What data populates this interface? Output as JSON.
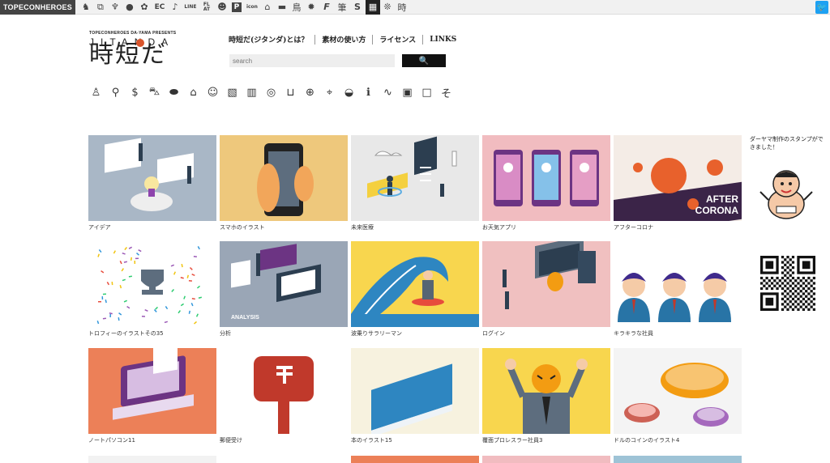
{
  "brand": "TOPECONHEROES",
  "top_icons": [
    "horse-icon",
    "copy-icon",
    "figure-icon",
    "chat-icon",
    "flower-icon",
    "EC",
    "music-icon",
    "LINE",
    "smile-icon",
    "P",
    "icon",
    "house-icon",
    "sofa-icon",
    "鳥",
    "blob-icon",
    "F",
    "筆",
    "S",
    "grid-icon",
    "時"
  ],
  "top_icon_labels": {
    "ec": "EC",
    "line": "LINE",
    "flat": "FL\nAT",
    "p": "P",
    "icon": "icon",
    "bird": "鳥",
    "f": "F",
    "fude": "筆",
    "s": "S",
    "ji": "時"
  },
  "logo": {
    "presents": "TOPECONHEROES DA-YAMA PRESENTS",
    "sub": "JITANDA",
    "title": "時短だ"
  },
  "nav": {
    "about": "時短だ(ジタンダ)とは？",
    "usage": "素材の使い方",
    "license": "ライセンス",
    "links": "LINKS"
  },
  "search": {
    "placeholder": "search"
  },
  "categories": [
    "person-icon",
    "tie-icon",
    "dollar-icon",
    "car-icon",
    "pill-icon",
    "house-icon",
    "cat-icon",
    "image-icon",
    "building-icon",
    "medal-icon",
    "sofa-icon",
    "ball-icon",
    "pin-icon",
    "cloud-icon",
    "info-icon",
    "curve-icon",
    "frame-icon",
    "square-icon",
    "so-icon"
  ],
  "cards": [
    {
      "caption": "アイデア",
      "bg": "#a9b7c6"
    },
    {
      "caption": "スマホのイラスト",
      "bg": "#eec87c"
    },
    {
      "caption": "未来医療",
      "bg": "#e8e8e8"
    },
    {
      "caption": "お天気アプリ",
      "bg": "#f1bcc0"
    },
    {
      "caption": "アフターコロナ",
      "bg": "#f4ece6",
      "overlay": "AFTER\nCORONA"
    },
    {
      "caption": "トロフィーのイラストその35",
      "bg": "#ffffff"
    },
    {
      "caption": "分析",
      "bg": "#9aa6b6",
      "overlay": "ANALYSIS"
    },
    {
      "caption": "波乗りサラリーマン",
      "bg": "#f8d64e"
    },
    {
      "caption": "ログイン",
      "bg": "#f0c0c0"
    },
    {
      "caption": "キラキラな社員",
      "bg": "#ffffff"
    },
    {
      "caption": "ノートパソコン11",
      "bg": "#ec8058"
    },
    {
      "caption": "郵便受け",
      "bg": "#ffffff"
    },
    {
      "caption": "本のイラスト15",
      "bg": "#f7f2df"
    },
    {
      "caption": "覆面プロレスラー社員3",
      "bg": "#f8d64e"
    },
    {
      "caption": "ドルのコインのイラスト4",
      "bg": "#f4f4f4"
    }
  ],
  "sidebar": {
    "message": "ダーヤマ制作のスタンプができました！"
  },
  "colors": {
    "accent": "#d9542b",
    "twitter": "#1da1f2"
  }
}
